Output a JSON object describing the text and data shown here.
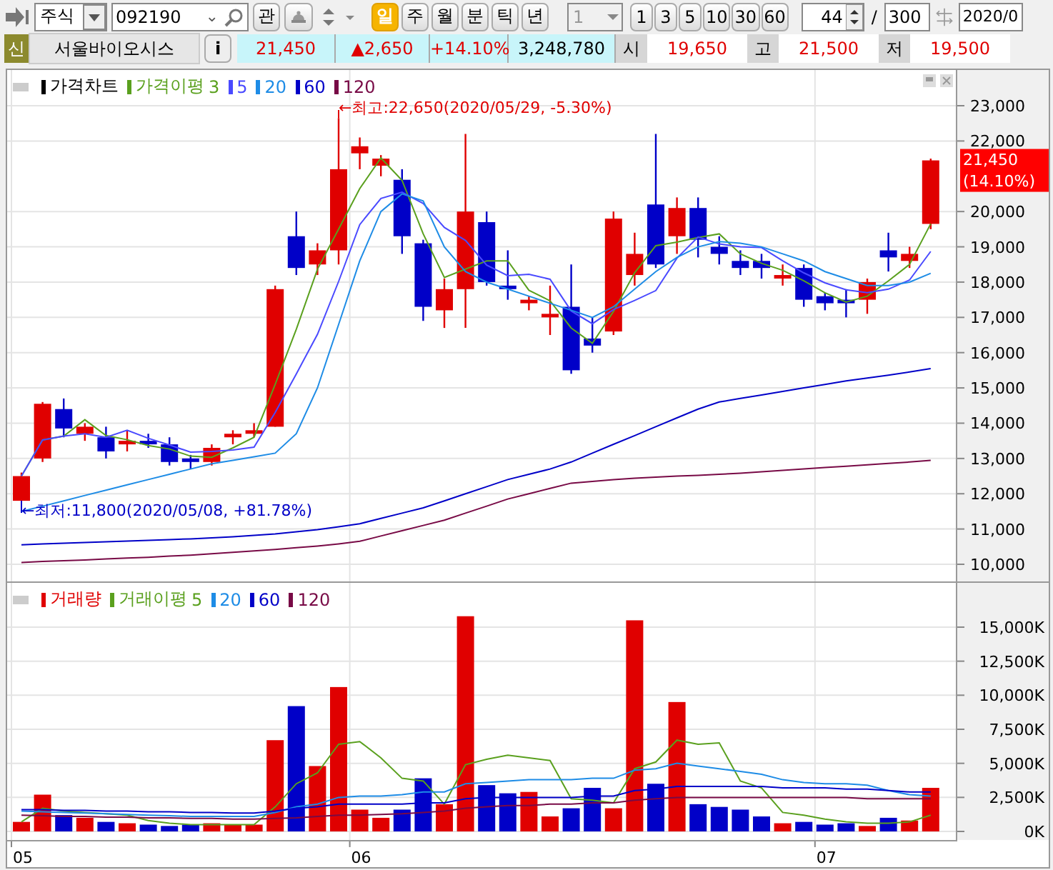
{
  "toolbar": {
    "market": "주식",
    "code": "092190",
    "code_menu": "⌄",
    "watch_button": "관",
    "periods": [
      {
        "label": "일",
        "selected": true
      },
      {
        "label": "주",
        "selected": false
      },
      {
        "label": "월",
        "selected": false
      },
      {
        "label": "분",
        "selected": false
      },
      {
        "label": "틱",
        "selected": false
      },
      {
        "label": "년",
        "selected": false
      }
    ],
    "interval_dropdown": {
      "value": "1",
      "disabled": true
    },
    "intervals": [
      "1",
      "3",
      "5",
      "10",
      "30",
      "60"
    ],
    "count": "44",
    "separator": "/",
    "total": "300",
    "date": "2020/0"
  },
  "quote": {
    "badge": "신",
    "name": "서울바이오시스",
    "info_button": "i",
    "price": "21,450",
    "change": "▲2,650",
    "change_pct": "+14.10%",
    "volume": "3,248,780",
    "stats": [
      {
        "label": "시",
        "value": "19,650"
      },
      {
        "label": "고",
        "value": "21,500"
      },
      {
        "label": "저",
        "value": "19,500"
      }
    ]
  },
  "price_panel": {
    "title": "가격차트",
    "average_label": "가격이평",
    "high_note": "←최고:22,650(2020/05/29, -5.30%)",
    "low_note": "←최저:11,800(2020/05/08, +81.78%)",
    "current_price": "21,450",
    "current_pct": "(14.10%)",
    "chart_data": {
      "type": "candlestick",
      "grid": true,
      "ylim": [
        10000,
        23000
      ],
      "yticks": [
        {
          "value": 10000,
          "label": "10,000"
        },
        {
          "value": 11000,
          "label": "11,000"
        },
        {
          "value": 12000,
          "label": "12,000"
        },
        {
          "value": 13000,
          "label": "13,000"
        },
        {
          "value": 14000,
          "label": "14,000"
        },
        {
          "value": 15000,
          "label": "15,000"
        },
        {
          "value": 16000,
          "label": "16,000"
        },
        {
          "value": 17000,
          "label": "17,000"
        },
        {
          "value": 18000,
          "label": "18,000"
        },
        {
          "value": 19000,
          "label": "19,000"
        },
        {
          "value": 20000,
          "label": "20,000"
        },
        {
          "value": 22000,
          "label": "22,000"
        },
        {
          "value": 23000,
          "label": "23,000"
        }
      ],
      "ohlc": [
        [
          11800,
          12600,
          11800,
          12500
        ],
        [
          13000,
          14600,
          12900,
          14550
        ],
        [
          14400,
          14700,
          13600,
          13850
        ],
        [
          13700,
          14000,
          13500,
          13900
        ],
        [
          13600,
          13900,
          13000,
          13200
        ],
        [
          13400,
          13800,
          13200,
          13500
        ],
        [
          13500,
          13700,
          13300,
          13400
        ],
        [
          13400,
          13600,
          12800,
          12900
        ],
        [
          13000,
          13100,
          12700,
          12900
        ],
        [
          12900,
          13400,
          12800,
          13300
        ],
        [
          13600,
          13800,
          13400,
          13700
        ],
        [
          13700,
          14000,
          13600,
          13800
        ],
        [
          13900,
          17900,
          13900,
          17800
        ],
        [
          19300,
          20000,
          18200,
          18400
        ],
        [
          18500,
          19100,
          18200,
          18900
        ],
        [
          18900,
          22650,
          18500,
          21200
        ],
        [
          21650,
          22100,
          21200,
          21850
        ],
        [
          21300,
          21600,
          21000,
          21500
        ],
        [
          20900,
          21200,
          18800,
          19300
        ],
        [
          19100,
          19200,
          16900,
          17300
        ],
        [
          17200,
          18100,
          16700,
          17800
        ],
        [
          17800,
          22200,
          16700,
          20000
        ],
        [
          19700,
          20000,
          17900,
          18000
        ],
        [
          17900,
          18900,
          17500,
          17800
        ],
        [
          17400,
          17600,
          17200,
          17500
        ],
        [
          17000,
          17900,
          16500,
          17100
        ],
        [
          17300,
          18500,
          15400,
          15500
        ],
        [
          16400,
          17000,
          16000,
          16200
        ],
        [
          16600,
          20000,
          16500,
          19800
        ],
        [
          18200,
          19400,
          17900,
          18800
        ],
        [
          20200,
          22200,
          18400,
          18500
        ],
        [
          19300,
          20400,
          18800,
          20100
        ],
        [
          20100,
          20400,
          18700,
          19200
        ],
        [
          19000,
          19300,
          18500,
          18800
        ],
        [
          18600,
          18900,
          18200,
          18400
        ],
        [
          18600,
          18800,
          18100,
          18400
        ],
        [
          18100,
          18500,
          17900,
          18200
        ],
        [
          18400,
          18500,
          17300,
          17500
        ],
        [
          17600,
          17700,
          17200,
          17400
        ],
        [
          17500,
          17800,
          17000,
          17400
        ],
        [
          17500,
          18100,
          17100,
          18000
        ],
        [
          18900,
          19400,
          18300,
          18700
        ],
        [
          18600,
          19000,
          18400,
          18800
        ],
        [
          19650,
          21500,
          19500,
          21450
        ]
      ],
      "series": [
        {
          "name": "3",
          "type": "line",
          "color": "#5aa01e",
          "values": [
            12500,
            13525,
            13633,
            14100,
            13650,
            13533,
            13367,
            13267,
            13067,
            13033,
            13300,
            13600,
            15100,
            16667,
            18367,
            19500,
            20650,
            21517,
            20883,
            19367,
            18133,
            18367,
            18600,
            18600,
            17767,
            17467,
            16700,
            16267,
            17167,
            18267,
            19033,
            19133,
            19267,
            19367,
            18800,
            18533,
            18333,
            18033,
            17700,
            17433,
            17600,
            18033,
            18500,
            19650
          ]
        },
        {
          "name": "5",
          "type": "line",
          "color": "#4a4aff",
          "values": [
            12500,
            13525,
            13633,
            13700,
            13600,
            13800,
            13570,
            13380,
            13180,
            13200,
            13240,
            13320,
            14300,
            15400,
            16520,
            18020,
            19630,
            20370,
            20550,
            20230,
            19550,
            19180,
            18480,
            18180,
            18220,
            18080,
            17180,
            16820,
            17220,
            17480,
            17760,
            18680,
            19280,
            19080,
            19000,
            18980,
            18600,
            18260,
            17980,
            17780,
            17700,
            17800,
            18060,
            18870
          ]
        },
        {
          "name": "20",
          "type": "line",
          "color": "#1e8ce6",
          "values": [
            11500,
            11650,
            11800,
            11950,
            12100,
            12250,
            12400,
            12550,
            12700,
            12850,
            12950,
            13050,
            13150,
            13700,
            15000,
            16800,
            18600,
            20000,
            20500,
            20300,
            19000,
            18300,
            18000,
            17800,
            17600,
            17400,
            17200,
            17000,
            17300,
            17800,
            18300,
            18700,
            19000,
            19150,
            19100,
            19000,
            18800,
            18600,
            18300,
            18100,
            17900,
            17900,
            18000,
            18250
          ]
        },
        {
          "name": "60",
          "type": "line",
          "color": "#0000c8",
          "values": [
            10550,
            10580,
            10600,
            10620,
            10640,
            10660,
            10680,
            10700,
            10720,
            10750,
            10780,
            10820,
            10860,
            10920,
            10980,
            11060,
            11150,
            11300,
            11450,
            11600,
            11800,
            12000,
            12200,
            12400,
            12550,
            12700,
            12900,
            13150,
            13400,
            13650,
            13900,
            14150,
            14400,
            14600,
            14700,
            14800,
            14900,
            15000,
            15100,
            15200,
            15280,
            15360,
            15450,
            15550
          ]
        },
        {
          "name": "120",
          "type": "line",
          "color": "#780a46",
          "values": [
            10050,
            10080,
            10100,
            10120,
            10150,
            10180,
            10200,
            10230,
            10260,
            10300,
            10340,
            10380,
            10420,
            10470,
            10520,
            10580,
            10650,
            10800,
            10950,
            11100,
            11250,
            11450,
            11650,
            11850,
            12000,
            12150,
            12300,
            12350,
            12400,
            12440,
            12470,
            12500,
            12520,
            12550,
            12580,
            12620,
            12660,
            12700,
            12740,
            12780,
            12820,
            12860,
            12900,
            12950
          ]
        }
      ]
    }
  },
  "volume_panel": {
    "average_label": "거래이평",
    "chart_data": {
      "type": "bar",
      "grid": true,
      "ylim": [
        0,
        18250
      ],
      "yticks": [
        {
          "value": 0,
          "label": "0K"
        },
        {
          "value": 2500,
          "label": "2,500K"
        },
        {
          "value": 5000,
          "label": "5,000K"
        },
        {
          "value": 7500,
          "label": "7,500K"
        },
        {
          "value": 10000,
          "label": "10,000K"
        },
        {
          "value": 12500,
          "label": "12,500K"
        },
        {
          "value": 15000,
          "label": "15,000K"
        }
      ],
      "categories": [
        "05",
        null,
        null,
        null,
        null,
        null,
        null,
        null,
        null,
        null,
        null,
        null,
        null,
        null,
        null,
        null,
        "06",
        null,
        null,
        null,
        null,
        null,
        null,
        null,
        null,
        null,
        null,
        null,
        null,
        null,
        null,
        null,
        null,
        null,
        null,
        null,
        null,
        null,
        "07",
        null,
        null,
        null,
        null,
        null
      ],
      "series": [
        {
          "name": "거래량",
          "color": "#e00000",
          "values": [
            700,
            2700,
            null,
            1000,
            null,
            600,
            null,
            null,
            null,
            600,
            500,
            500,
            6700,
            null,
            4800,
            10600,
            1600,
            1000,
            null,
            null,
            2000,
            15800,
            null,
            null,
            2900,
            1100,
            null,
            null,
            1700,
            15500,
            null,
            9500,
            null,
            null,
            null,
            null,
            600,
            null,
            null,
            null,
            400,
            null,
            800,
            3200
          ]
        },
        {
          "color": "#0000c8",
          "values": [
            null,
            null,
            1200,
            null,
            700,
            null,
            500,
            400,
            500,
            null,
            null,
            null,
            null,
            9200,
            null,
            null,
            null,
            null,
            1600,
            3900,
            null,
            null,
            3400,
            2800,
            null,
            null,
            1700,
            3200,
            null,
            null,
            3500,
            null,
            2000,
            1800,
            1600,
            1100,
            null,
            700,
            500,
            600,
            null,
            1000,
            null,
            null
          ]
        },
        {
          "name": "5",
          "type": "line",
          "color": "#5aa01e",
          "values": [
            700,
            1700,
            1500,
            1400,
            1300,
            1200,
            800,
            600,
            500,
            500,
            500,
            500,
            1800,
            3500,
            4300,
            6400,
            6600,
            5400,
            3900,
            3700,
            2000,
            4900,
            5300,
            5600,
            5400,
            5200,
            2400,
            2300,
            2100,
            4600,
            5100,
            6700,
            6400,
            6500,
            3700,
            3200,
            1400,
            1200,
            900,
            700,
            600,
            600,
            700,
            1200
          ]
        },
        {
          "name": "20",
          "type": "line",
          "color": "#1e8ce6",
          "values": [
            1500,
            1450,
            1400,
            1350,
            1300,
            1250,
            1200,
            1150,
            1100,
            1100,
            1100,
            1100,
            1400,
            1800,
            2000,
            2500,
            2600,
            2600,
            2700,
            2900,
            2900,
            3500,
            3600,
            3700,
            3800,
            3800,
            3800,
            3900,
            3900,
            4500,
            4600,
            5000,
            4800,
            4600,
            4400,
            4200,
            3800,
            3600,
            3500,
            3500,
            3400,
            3000,
            2700,
            2600
          ]
        },
        {
          "name": "60",
          "type": "line",
          "color": "#0000c8",
          "values": [
            1600,
            1600,
            1550,
            1550,
            1500,
            1500,
            1450,
            1450,
            1400,
            1400,
            1350,
            1350,
            1500,
            1700,
            1800,
            2000,
            2000,
            2000,
            2000,
            2100,
            2100,
            2400,
            2500,
            2500,
            2500,
            2500,
            2500,
            2600,
            2600,
            3000,
            3100,
            3300,
            3300,
            3300,
            3300,
            3300,
            3200,
            3200,
            3200,
            3100,
            3100,
            3000,
            2900,
            2900
          ]
        },
        {
          "name": "120",
          "type": "line",
          "color": "#780a46",
          "values": [
            1200,
            1150,
            1100,
            1100,
            1050,
            1050,
            1000,
            1000,
            950,
            950,
            900,
            900,
            950,
            1000,
            1100,
            1200,
            1200,
            1250,
            1300,
            1400,
            1500,
            1700,
            1800,
            1900,
            1900,
            2000,
            2000,
            2100,
            2100,
            2300,
            2400,
            2500,
            2500,
            2500,
            2500,
            2500,
            2500,
            2500,
            2500,
            2500,
            2400,
            2400,
            2400,
            2400
          ]
        }
      ]
    }
  }
}
